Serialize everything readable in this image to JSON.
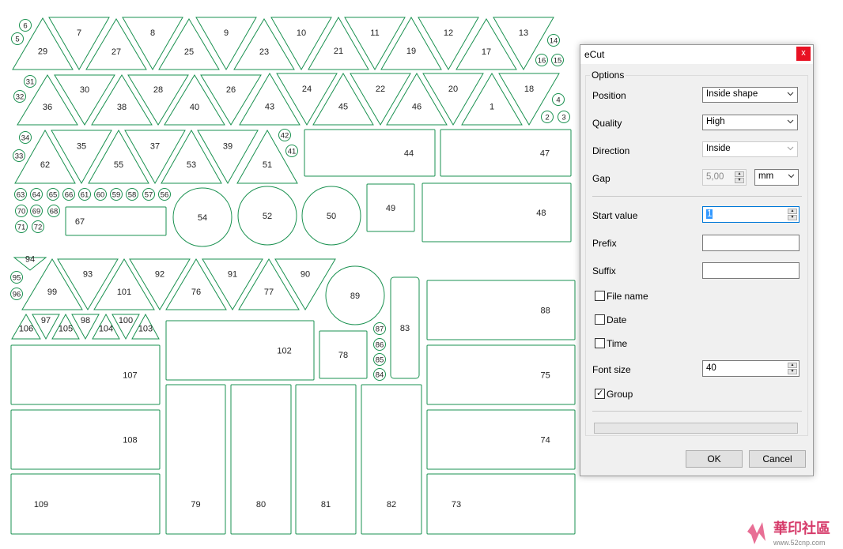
{
  "canvas": {
    "stroke_color": "#1a9150",
    "shapes": [
      {
        "label": "29"
      },
      {
        "label": "7"
      },
      {
        "label": "27"
      },
      {
        "label": "8"
      },
      {
        "label": "25"
      },
      {
        "label": "9"
      },
      {
        "label": "23"
      },
      {
        "label": "10"
      },
      {
        "label": "21"
      },
      {
        "label": "11"
      },
      {
        "label": "19"
      },
      {
        "label": "12"
      },
      {
        "label": "17"
      },
      {
        "label": "13"
      },
      {
        "label": "36"
      },
      {
        "label": "30"
      },
      {
        "label": "38"
      },
      {
        "label": "28"
      },
      {
        "label": "40"
      },
      {
        "label": "26"
      },
      {
        "label": "43"
      },
      {
        "label": "24"
      },
      {
        "label": "45"
      },
      {
        "label": "22"
      },
      {
        "label": "46"
      },
      {
        "label": "20"
      },
      {
        "label": "1"
      },
      {
        "label": "18"
      },
      {
        "label": "62"
      },
      {
        "label": "35"
      },
      {
        "label": "55"
      },
      {
        "label": "37"
      },
      {
        "label": "53"
      },
      {
        "label": "39"
      },
      {
        "label": "51"
      },
      {
        "label": "44"
      },
      {
        "label": "47"
      },
      {
        "label": "48"
      },
      {
        "label": "49"
      },
      {
        "label": "54"
      },
      {
        "label": "52"
      },
      {
        "label": "50"
      },
      {
        "label": "67"
      },
      {
        "label": "99"
      },
      {
        "label": "93"
      },
      {
        "label": "101"
      },
      {
        "label": "92"
      },
      {
        "label": "76"
      },
      {
        "label": "91"
      },
      {
        "label": "77"
      },
      {
        "label": "90"
      },
      {
        "label": "94"
      },
      {
        "label": "89"
      },
      {
        "label": "106"
      },
      {
        "label": "97"
      },
      {
        "label": "105"
      },
      {
        "label": "98"
      },
      {
        "label": "104"
      },
      {
        "label": "100"
      },
      {
        "label": "103"
      },
      {
        "label": "107"
      },
      {
        "label": "102"
      },
      {
        "label": "78"
      },
      {
        "label": "83"
      },
      {
        "label": "88"
      },
      {
        "label": "75"
      },
      {
        "label": "108"
      },
      {
        "label": "74"
      },
      {
        "label": "109"
      },
      {
        "label": "79"
      },
      {
        "label": "80"
      },
      {
        "label": "81"
      },
      {
        "label": "82"
      },
      {
        "label": "73"
      }
    ],
    "small_circles": [
      "6",
      "5",
      "14",
      "16",
      "15",
      "31",
      "32",
      "4",
      "2",
      "3",
      "34",
      "33",
      "42",
      "41",
      "63",
      "64",
      "65",
      "66",
      "61",
      "60",
      "59",
      "58",
      "57",
      "56",
      "70",
      "69",
      "68",
      "71",
      "72",
      "95",
      "96",
      "87",
      "86",
      "85",
      "84"
    ]
  },
  "dialog": {
    "title": "eCut",
    "close_label": "x",
    "group_label": "Options",
    "position_label": "Position",
    "position_value": "Inside shape",
    "quality_label": "Quality",
    "quality_value": "High",
    "direction_label": "Direction",
    "direction_value": "Inside",
    "gap_label": "Gap",
    "gap_value": "5,00",
    "gap_unit": "mm",
    "start_label": "Start value",
    "start_value": "1",
    "prefix_label": "Prefix",
    "prefix_value": "",
    "suffix_label": "Suffix",
    "suffix_value": "",
    "file_name_label": "File name",
    "date_label": "Date",
    "time_label": "Time",
    "fontsize_label": "Font size",
    "fontsize_value": "40",
    "group_checkbox_label": "Group",
    "group_checked": true,
    "ok_label": "OK",
    "cancel_label": "Cancel"
  },
  "watermark": {
    "text": "華印社區",
    "url": "www.52cnp.com"
  }
}
